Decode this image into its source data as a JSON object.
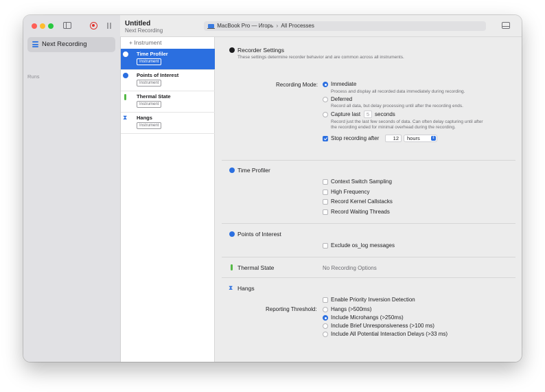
{
  "window": {
    "document_title": "Untitled",
    "document_subtitle": "Next Recording",
    "target_device": "MacBook Pro — Игорь",
    "target_process": "All Processes"
  },
  "sidebar": {
    "items": [
      {
        "label": "Next Recording"
      }
    ],
    "runs_label": "Runs"
  },
  "instrument_list": {
    "add_label": "+ Instrument",
    "items": [
      {
        "name": "Time Profiler",
        "tag": "Instrument",
        "selected": true
      },
      {
        "name": "Points of Interest",
        "tag": "Instrument"
      },
      {
        "name": "Thermal State",
        "tag": "Instrument"
      },
      {
        "name": "Hangs",
        "tag": "Instrument"
      }
    ]
  },
  "recorder_settings": {
    "title": "Recorder Settings",
    "description": "These settings determine recorder behavior and are common across all instruments.",
    "recording_mode_label": "Recording Mode:",
    "immediate_label": "Immediate",
    "immediate_desc": "Process and display all recorded data immediately during recording.",
    "deferred_label": "Deferred",
    "deferred_desc": "Record all data, but delay processing until after the recording ends.",
    "capture_last_label": "Capture last",
    "capture_last_value": "5",
    "capture_last_unit": "seconds",
    "capture_last_desc_1": "Record just the last few seconds of data. Can often delay capturing until after",
    "capture_last_desc_2": "the recording ended for minimal overhead during the recording.",
    "stop_after_label": "Stop recording after",
    "stop_after_value": "12",
    "stop_after_unit": "hours",
    "selected_mode": "Immediate",
    "stop_after_checked": true
  },
  "time_profiler": {
    "title": "Time Profiler",
    "options": [
      {
        "label": "Context Switch Sampling",
        "checked": false
      },
      {
        "label": "High Frequency",
        "checked": false
      },
      {
        "label": "Record Kernel Callstacks",
        "checked": false
      },
      {
        "label": "Record Waiting Threads",
        "checked": false
      }
    ]
  },
  "points_of_interest": {
    "title": "Points of Interest",
    "options": [
      {
        "label": "Exclude os_log messages",
        "checked": false
      }
    ]
  },
  "thermal_state": {
    "title": "Thermal State",
    "no_options": "No Recording Options"
  },
  "hangs": {
    "title": "Hangs",
    "priority_label": "Enable Priority Inversion Detection",
    "threshold_label": "Reporting Threshold:",
    "thresholds": [
      {
        "label": "Hangs (>500ms)",
        "selected": false
      },
      {
        "label": "Include Microhangs (>250ms)",
        "selected": true
      },
      {
        "label": "Include Brief Unresponsiveness (>100 ms)",
        "selected": false
      },
      {
        "label": "Include All Potential Interaction Delays (>33 ms)",
        "selected": false
      }
    ]
  },
  "colors": {
    "accent": "#2b6fe0",
    "record": "#e0322c",
    "thermal": "#54b946"
  }
}
